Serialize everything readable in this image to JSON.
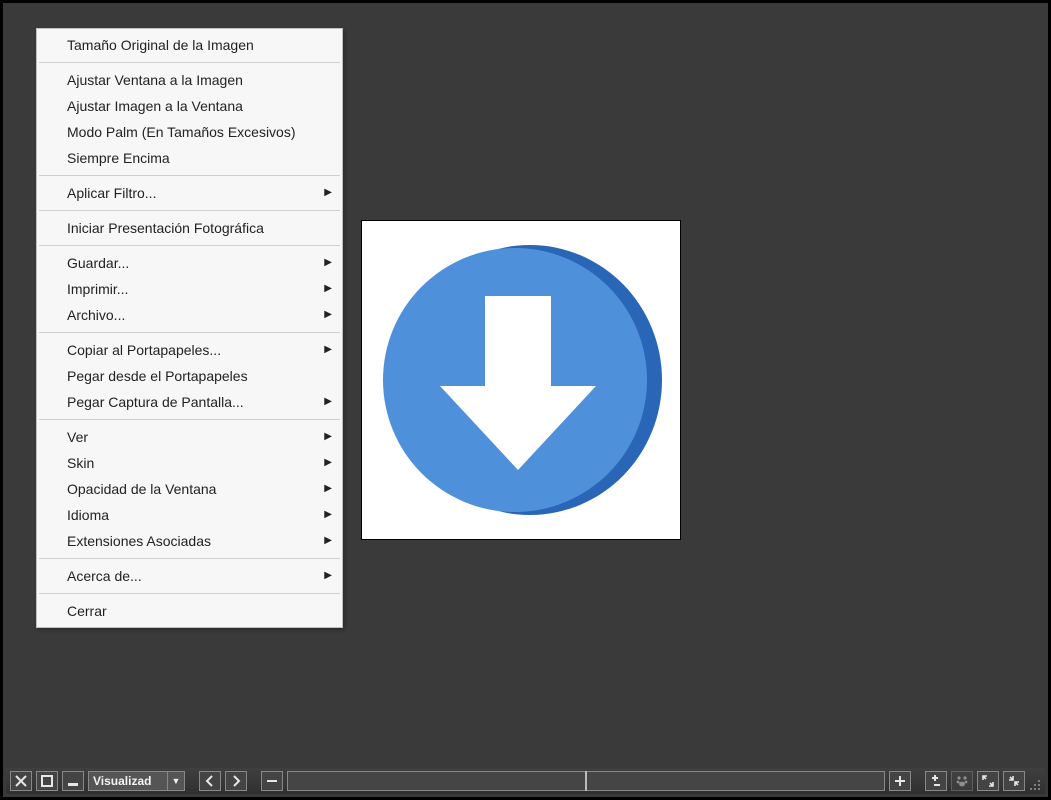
{
  "context_menu": {
    "groups": [
      [
        {
          "label": "Tamaño Original de la Imagen",
          "submenu": false
        }
      ],
      [
        {
          "label": "Ajustar Ventana a la Imagen",
          "submenu": false
        },
        {
          "label": "Ajustar Imagen a la Ventana",
          "submenu": false
        },
        {
          "label": "Modo Palm (En Tamaños Excesivos)",
          "submenu": false
        },
        {
          "label": "Siempre Encima",
          "submenu": false
        }
      ],
      [
        {
          "label": "Aplicar Filtro...",
          "submenu": true
        }
      ],
      [
        {
          "label": "Iniciar Presentación Fotográfica",
          "submenu": false
        }
      ],
      [
        {
          "label": "Guardar...",
          "submenu": true
        },
        {
          "label": "Imprimir...",
          "submenu": true
        },
        {
          "label": "Archivo...",
          "submenu": true
        }
      ],
      [
        {
          "label": "Copiar al Portapapeles...",
          "submenu": true
        },
        {
          "label": "Pegar desde el Portapapeles",
          "submenu": false
        },
        {
          "label": "Pegar Captura de Pantalla...",
          "submenu": true
        }
      ],
      [
        {
          "label": "Ver",
          "submenu": true
        },
        {
          "label": "Skin",
          "submenu": true
        },
        {
          "label": "Opacidad de la Ventana",
          "submenu": true
        },
        {
          "label": "Idioma",
          "submenu": true
        },
        {
          "label": "Extensiones Asociadas",
          "submenu": true
        }
      ],
      [
        {
          "label": "Acerca de...",
          "submenu": true
        }
      ],
      [
        {
          "label": "Cerrar",
          "submenu": false
        }
      ]
    ]
  },
  "bottom_bar": {
    "mode_label": "Visualizad",
    "seek_position_pct": 50
  },
  "image": {
    "description": "Blue circular download-arrow icon",
    "primary_color": "#4e90d9",
    "shadow_color": "#2a66b7"
  }
}
